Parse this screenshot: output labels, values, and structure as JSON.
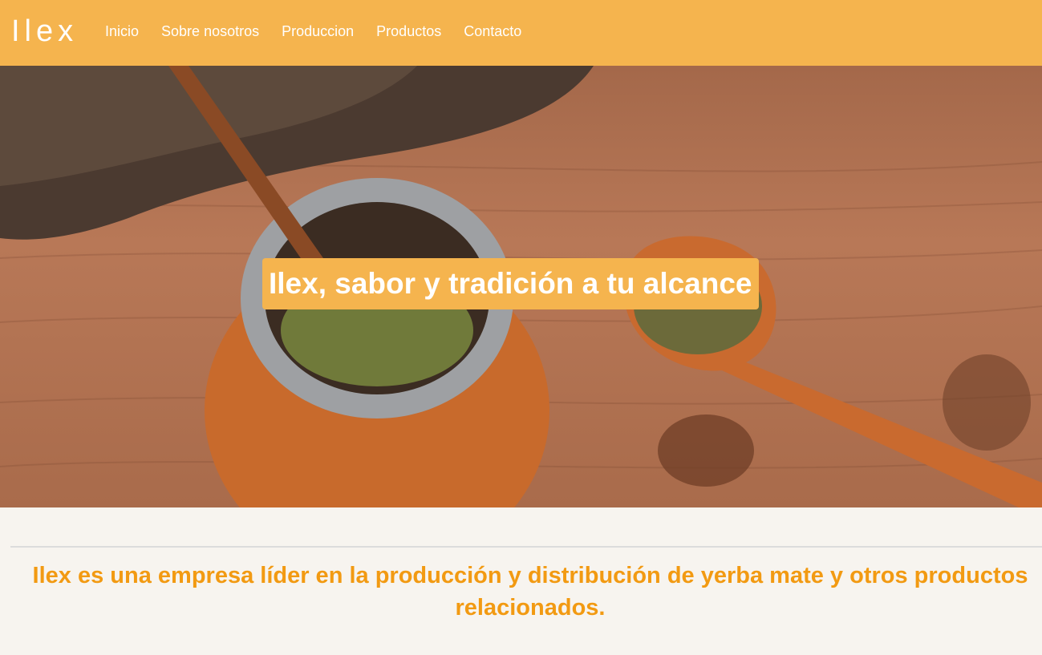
{
  "brand": {
    "logo_text": "Ilex"
  },
  "nav": {
    "items": [
      {
        "label": "Inicio"
      },
      {
        "label": "Sobre nosotros"
      },
      {
        "label": "Produccion"
      },
      {
        "label": "Productos"
      },
      {
        "label": "Contacto"
      }
    ]
  },
  "hero": {
    "title": "Ilex, sabor y tradición a tu alcance"
  },
  "intro": {
    "text": "Ilex es una empresa líder en la producción y distribución de yerba mate y otros productos relacionados."
  },
  "colors": {
    "header_bg": "#f5b44e",
    "accent_text": "#f29a12",
    "page_bg": "#f7f4ef"
  }
}
